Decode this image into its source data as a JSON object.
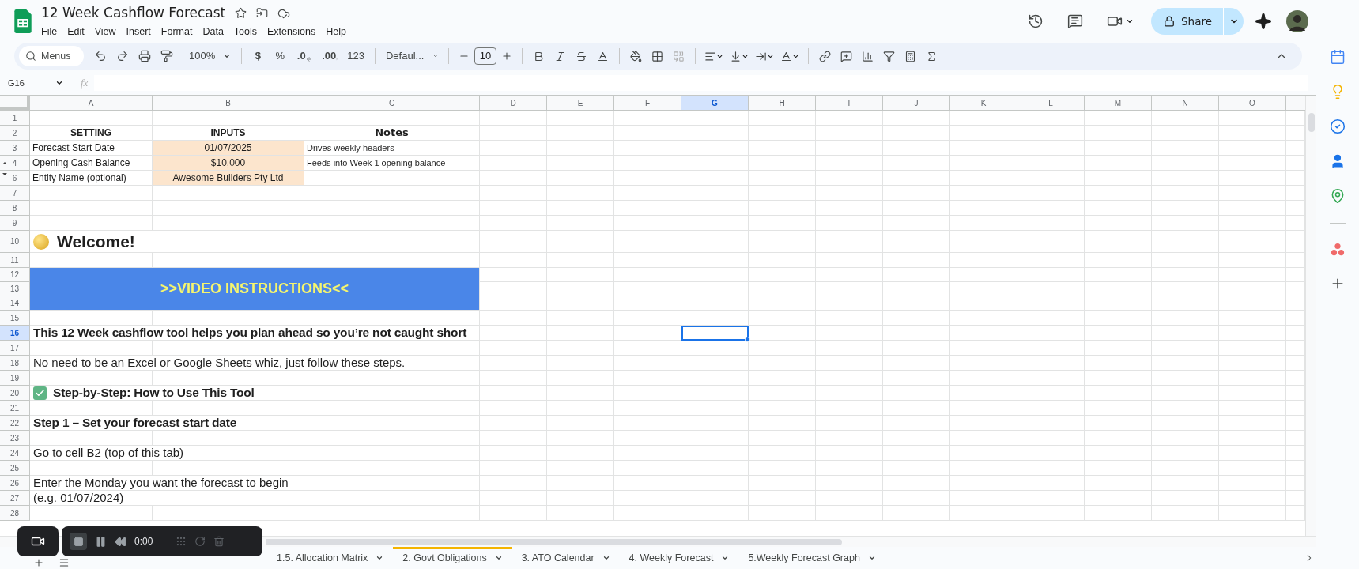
{
  "document": {
    "title": "12 Week Cashflow Forecast",
    "menu": [
      "File",
      "Edit",
      "View",
      "Insert",
      "Format",
      "Data",
      "Tools",
      "Extensions",
      "Help"
    ]
  },
  "header_actions": {
    "share": "Share"
  },
  "toolbar": {
    "search_placeholder": "Menus",
    "zoom": "100%",
    "currency": "$",
    "percent": "%",
    "decrease_decimals": ".0",
    "increase_decimals": ".00",
    "number_format": "123",
    "font": "Defaul...",
    "font_size": "10"
  },
  "formula_bar": {
    "name_box": "G16",
    "fx": "fx"
  },
  "columns": [
    {
      "label": "A",
      "selected": false
    },
    {
      "label": "B",
      "selected": false
    },
    {
      "label": "C",
      "selected": false
    },
    {
      "label": "D",
      "selected": false
    },
    {
      "label": "E",
      "selected": false
    },
    {
      "label": "F",
      "selected": false
    },
    {
      "label": "G",
      "selected": true
    },
    {
      "label": "H",
      "selected": false
    },
    {
      "label": "I",
      "selected": false
    },
    {
      "label": "J",
      "selected": false
    },
    {
      "label": "K",
      "selected": false
    },
    {
      "label": "L",
      "selected": false
    },
    {
      "label": "M",
      "selected": false
    },
    {
      "label": "N",
      "selected": false
    },
    {
      "label": "O",
      "selected": false
    }
  ],
  "rows": [
    {
      "kind": "blank",
      "number": "1",
      "selected": false
    },
    {
      "kind": "header",
      "number": "2",
      "selected": false,
      "cells": [
        "SETTING",
        "INPUTS",
        "Notes"
      ]
    },
    {
      "kind": "input",
      "number": "3",
      "selected": false,
      "setting": "Forecast Start Date",
      "input": "01/07/2025",
      "note": "Drives weekly headers"
    },
    {
      "kind": "input",
      "number": "4",
      "selected": false,
      "collapse_marker": true,
      "setting": "Opening Cash Balance",
      "input": "$10,000",
      "note": "Feeds into Week 1 opening balance"
    },
    {
      "kind": "input",
      "number": "6",
      "selected": false,
      "expand_marker": true,
      "setting": "Entity Name (optional)",
      "input": "Awesome Builders Pty Ltd"
    },
    {
      "kind": "blank",
      "number": "7",
      "selected": false
    },
    {
      "kind": "blank",
      "number": "8",
      "selected": false
    },
    {
      "kind": "blank",
      "number": "9",
      "selected": false
    },
    {
      "kind": "title",
      "number": "10",
      "selected": false,
      "text": "Welcome!"
    },
    {
      "kind": "blank",
      "number": "11",
      "selected": false
    },
    {
      "kind": "banner",
      "numbers": [
        "12",
        "13",
        "14"
      ],
      "selected": false,
      "text": ">>VIDEO INSTRUCTIONS<<"
    },
    {
      "kind": "blank",
      "number": "15",
      "selected": false
    },
    {
      "kind": "heading",
      "number": "16",
      "selected": true,
      "text": "This 12 Week cashflow tool helps you plan ahead so you’re not caught short"
    },
    {
      "kind": "blank",
      "number": "17",
      "selected": false
    },
    {
      "kind": "text",
      "number": "18",
      "selected": false,
      "text": "No need to be an Excel or Google Sheets whiz, just follow these steps."
    },
    {
      "kind": "blank",
      "number": "19",
      "selected": false
    },
    {
      "kind": "check_heading",
      "number": "20",
      "selected": false,
      "text": "Step-by-Step: How to Use This Tool"
    },
    {
      "kind": "blank",
      "number": "21",
      "selected": false
    },
    {
      "kind": "heading",
      "number": "22",
      "selected": false,
      "text": "Step 1 – Set your forecast start date"
    },
    {
      "kind": "blank",
      "number": "23",
      "selected": false
    },
    {
      "kind": "text",
      "number": "24",
      "selected": false,
      "text": "Go to cell B2 (top of this tab)"
    },
    {
      "kind": "blank",
      "number": "25",
      "selected": false
    },
    {
      "kind": "text",
      "number": "26",
      "selected": false,
      "text": "Enter the Monday you want the forecast to begin"
    },
    {
      "kind": "text",
      "number": "27",
      "selected": false,
      "text": "(e.g. 01/07/2024)"
    },
    {
      "kind": "blank",
      "number": "28",
      "selected": false
    }
  ],
  "sheet_tabs": [
    {
      "label": "1.5. Allocation Matrix",
      "selected": false
    },
    {
      "label": "2. Govt Obligations",
      "selected": false,
      "color": "#f4b400"
    },
    {
      "label": "3. ATO Calendar",
      "selected": false
    },
    {
      "label": "4. Weekly Forecast",
      "selected": false
    },
    {
      "label": "5.Weekly Forecast Graph",
      "selected": false
    }
  ],
  "recorder": {
    "time": "0:00"
  }
}
